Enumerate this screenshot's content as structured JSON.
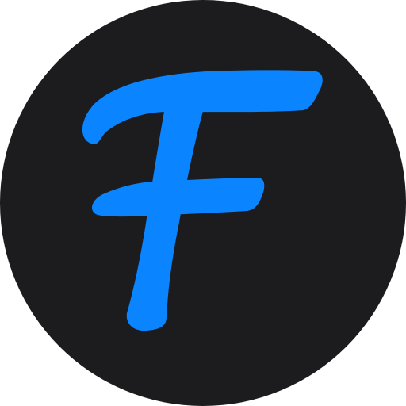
{
  "logo": {
    "letter": "F",
    "icon": "f-logo-icon",
    "colors": {
      "background": "#1c1c1e",
      "letter": "#0a84ff",
      "page": "#ffffff"
    }
  }
}
